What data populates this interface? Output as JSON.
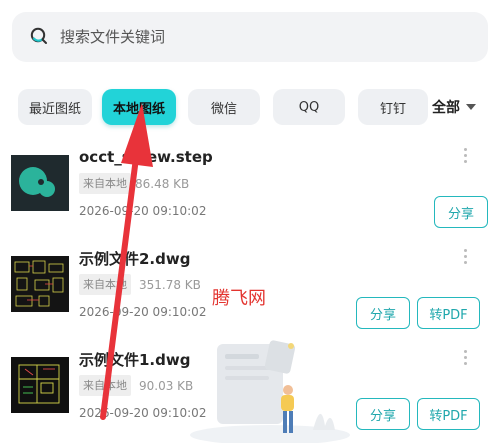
{
  "search": {
    "placeholder": "搜索文件关键词"
  },
  "tabs": [
    {
      "label": "最近图纸",
      "active": false
    },
    {
      "label": "本地图纸",
      "active": true
    },
    {
      "label": "微信",
      "active": false
    },
    {
      "label": "QQ",
      "active": false
    },
    {
      "label": "钉钉",
      "active": false
    }
  ],
  "filter": {
    "label": "全部"
  },
  "files": [
    {
      "name": "occt_screw.step",
      "source": "来自本地",
      "size": "86.48 KB",
      "date": "2026-09-20 09:10:02",
      "actions": [
        "分享"
      ]
    },
    {
      "name": "示例文件2.dwg",
      "source": "来自本地",
      "size": "351.78 KB",
      "date": "2026-09-20 09:10:02",
      "actions": [
        "分享",
        "转PDF"
      ]
    },
    {
      "name": "示例文件1.dwg",
      "source": "来自本地",
      "size": "90.03 KB",
      "date": "2026-09-20 09:10:02",
      "actions": [
        "分享",
        "转PDF"
      ]
    }
  ],
  "watermark": "腾飞网",
  "colors": {
    "accent": "#22d3d8",
    "button_border": "#24b8bd",
    "annotation_arrow": "#e8333a"
  }
}
